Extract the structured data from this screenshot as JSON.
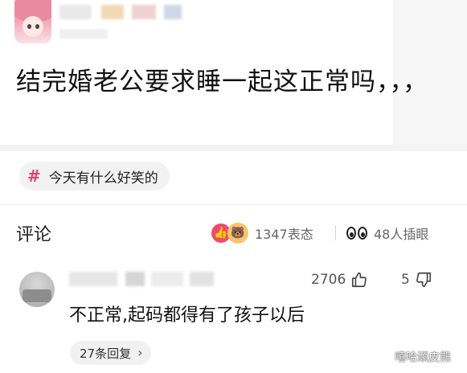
{
  "post": {
    "title": "结完婚老公要求睡一起这正常吗，，，"
  },
  "tag": {
    "icon": "hash-icon",
    "label": "今天有什么好笑的"
  },
  "comments_header": {
    "title": "评论",
    "reactions_count": "1347表态",
    "collections_count": "48人插眼"
  },
  "comment": {
    "likes": "2706",
    "dislikes": "5",
    "text": "不正常,起码都得有了孩子以后",
    "replies_label": "27条回复"
  },
  "watermark": {
    "text": "嘻哈顽皮熊"
  },
  "colors": {
    "accent": "#e0436a",
    "like_badge": "#ef4a6b",
    "chip_bg": "#f2f2f2"
  }
}
